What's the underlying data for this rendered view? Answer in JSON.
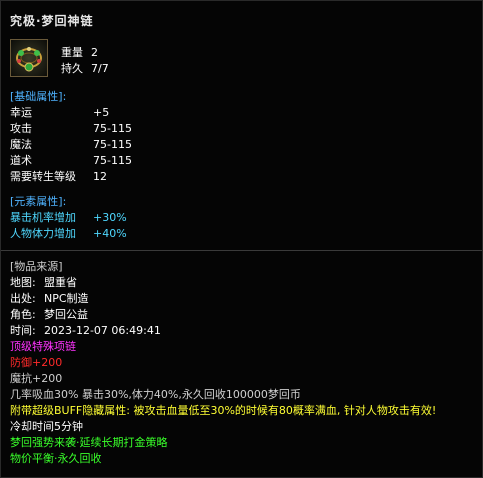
{
  "item": {
    "title": "究极·梦回神链",
    "icon": "jade-necklace-icon",
    "weight_label": "重量",
    "weight_value": "2",
    "durability_label": "持久",
    "durability_value": "7/7"
  },
  "basic": {
    "header": "[基础属性]:",
    "rows": [
      {
        "label": "幸运",
        "value": "+5"
      },
      {
        "label": "攻击",
        "value": "75-115"
      },
      {
        "label": "魔法",
        "value": "75-115"
      },
      {
        "label": "道术",
        "value": "75-115"
      },
      {
        "label": "需要转生等级",
        "value": "12"
      }
    ]
  },
  "element": {
    "header": "[元素属性]:",
    "rows": [
      {
        "label": "暴击机率增加",
        "value": "+30%"
      },
      {
        "label": "人物体力增加",
        "value": "+40%"
      }
    ]
  },
  "source": {
    "header": "[物品来源]",
    "map_label": "地图:",
    "map_value": "盟重省",
    "origin_label": "出处:",
    "origin_value": "NPC制造",
    "role_label": "角色:",
    "role_value": "梦回公益",
    "time_label": "时间:",
    "time_value": "2023-12-07 06:49:41"
  },
  "extras": {
    "type_line": "顶级特殊项链",
    "defense_line": "防御+200",
    "magic_resist_line": "魔抗+200",
    "bonus_line": "几率吸血30% 暴击30%,体力40%,永久回收100000梦回币",
    "hidden_attr_line": "附带超级BUFF隐藏属性: 被攻击血量低至30%的时候有80概率满血, 针对人物攻击有效!",
    "cooldown_line": "冷却时间5分钟",
    "promo_line": "梦回强势来袭·延续长期打金策略",
    "balance_line": "物价平衡·永久回收"
  },
  "colors": {
    "header_blue": "#4fb3ff",
    "element_cyan": "#4fd8ff",
    "green": "#39ff2a",
    "magenta": "#ff33ff",
    "red": "#ff2a2a",
    "yellow": "#ffff33"
  }
}
